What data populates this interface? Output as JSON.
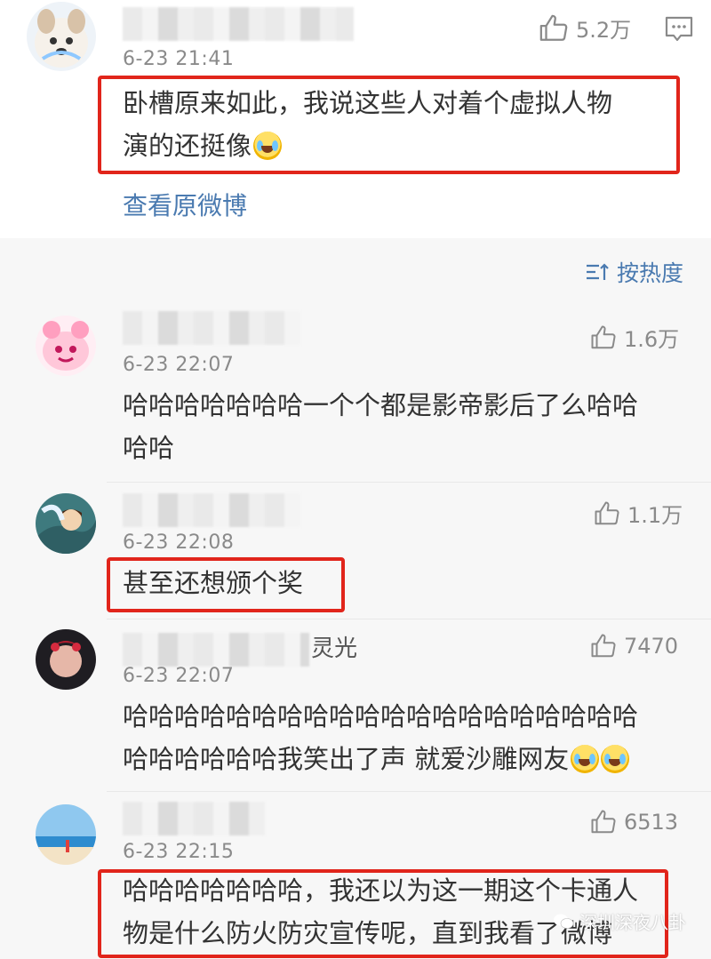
{
  "original_post": {
    "time": "6-23 21:41",
    "likes": "5.2万",
    "text_line1": "卧槽原来如此，我说这些人对着个虚拟人物",
    "text_line2": "演的还挺像",
    "emoji": "laugh-cry-emoji",
    "view_original_label": "查看原微博"
  },
  "sort_label": "按热度",
  "comments": [
    {
      "time": "6-23 22:07",
      "likes": "1.6万",
      "line1": "哈哈哈哈哈哈哈一个个都是影帝影后了么哈哈",
      "line2": "哈哈"
    },
    {
      "time": "6-23 22:08",
      "likes": "1.1万",
      "line1": "甚至还想颁个奖"
    },
    {
      "time": "6-23 22:07",
      "likes": "7470",
      "name_fragment": "灵光",
      "line1": "哈哈哈哈哈哈哈哈哈哈哈哈哈哈哈哈哈哈哈哈",
      "line2": "哈哈哈哈哈哈我笑出了声  就爱沙雕网友"
    },
    {
      "time": "6-23 22:15",
      "likes": "6513",
      "line1": "哈哈哈哈哈哈哈，我还以为这一期这个卡通人",
      "line2": "物是什么防火防灾宣传呢，直到我看了微博"
    }
  ],
  "watermark": "深圳深夜八卦",
  "colors": {
    "highlight": "#e1251b",
    "link": "#4a7ab0",
    "meta": "#8a8a8a"
  }
}
